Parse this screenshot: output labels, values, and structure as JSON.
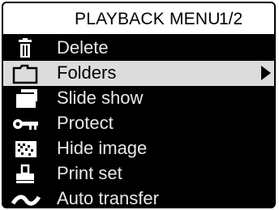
{
  "header": {
    "title": "PLAYBACK MENU",
    "page": "1/2"
  },
  "menu": {
    "items": [
      {
        "label": "Delete",
        "icon": "trash-icon"
      },
      {
        "label": "Folders",
        "icon": "folder-icon",
        "selected": true
      },
      {
        "label": "Slide show",
        "icon": "slide-show-icon"
      },
      {
        "label": "Protect",
        "icon": "key-icon"
      },
      {
        "label": "Hide image",
        "icon": "hide-image-icon"
      },
      {
        "label": "Print set",
        "icon": "print-icon"
      },
      {
        "label": "Auto transfer",
        "icon": "transfer-icon"
      }
    ]
  },
  "colors": {
    "background": "#000000",
    "header_background": "#ffffff",
    "selected_background": "#dcdcdc",
    "item_text": "#e8e8e8"
  }
}
